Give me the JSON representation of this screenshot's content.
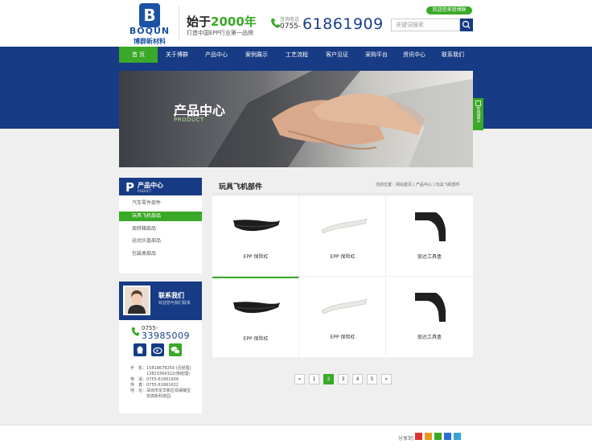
{
  "header": {
    "logo_letter": "B",
    "logo_en": "BOQUN",
    "logo_cn": "博群新材料",
    "slogan_prefix": "始于",
    "slogan_year": "2000年",
    "slogan_sub": "打造中国EPP行业第一品牌",
    "hotline_label": "咨询电话",
    "hotline_prefix": "0755-",
    "hotline_number": "61861909",
    "top_button": "欢迎您来到博群",
    "search_placeholder": "关键词搜索"
  },
  "nav": {
    "items": [
      "首 页",
      "关于博群",
      "产品中心",
      "案例展示",
      "工艺流程",
      "客户见证",
      "采购平台",
      "资讯中心",
      "联系我们"
    ]
  },
  "banner": {
    "title": "产品中心",
    "subtitle": "PRODUCT",
    "side_tab": "在线留言"
  },
  "sidebar": {
    "letter": "P",
    "title": "产品中心",
    "title_en": "RODUCT",
    "items": [
      "汽车零件部件",
      "玩具飞机部品",
      "周转箱部品",
      "运动头盔部品",
      "包装类部品"
    ]
  },
  "contact": {
    "title": "联系我们",
    "subtitle": "欢迎您与我们联系",
    "phone_prefix": "0755-",
    "phone_number": "33985009",
    "lines": [
      "手　机：15818678259 (吕经理)",
      "　　　　13823364322(熊经理)",
      "电　话：0755-61861909",
      "传　真：0755-61861622",
      "地　址：深圳市龙华新区观澜镇宝",
      "　　　　安高新科技园"
    ]
  },
  "main": {
    "title": "玩具飞机部件",
    "breadcrumb": "当前位置：网站首页 | 产品中心 | 玩具飞机部件",
    "products": [
      {
        "label": "EPP 保险杠"
      },
      {
        "label": "EPP 保险杠"
      },
      {
        "label": "驱达工具盒"
      },
      {
        "label": "EPP 保险杠"
      },
      {
        "label": "EPP 保险杠"
      },
      {
        "label": "驱达工具盒"
      }
    ]
  },
  "pagination": {
    "prev": "«",
    "pages": [
      "1",
      "2",
      "3",
      "4",
      "5"
    ],
    "current": "2",
    "next": "»"
  },
  "footer": {
    "share_label": "分享到："
  },
  "colors": {
    "brand_blue": "#173b84",
    "brand_green": "#3aa828"
  }
}
